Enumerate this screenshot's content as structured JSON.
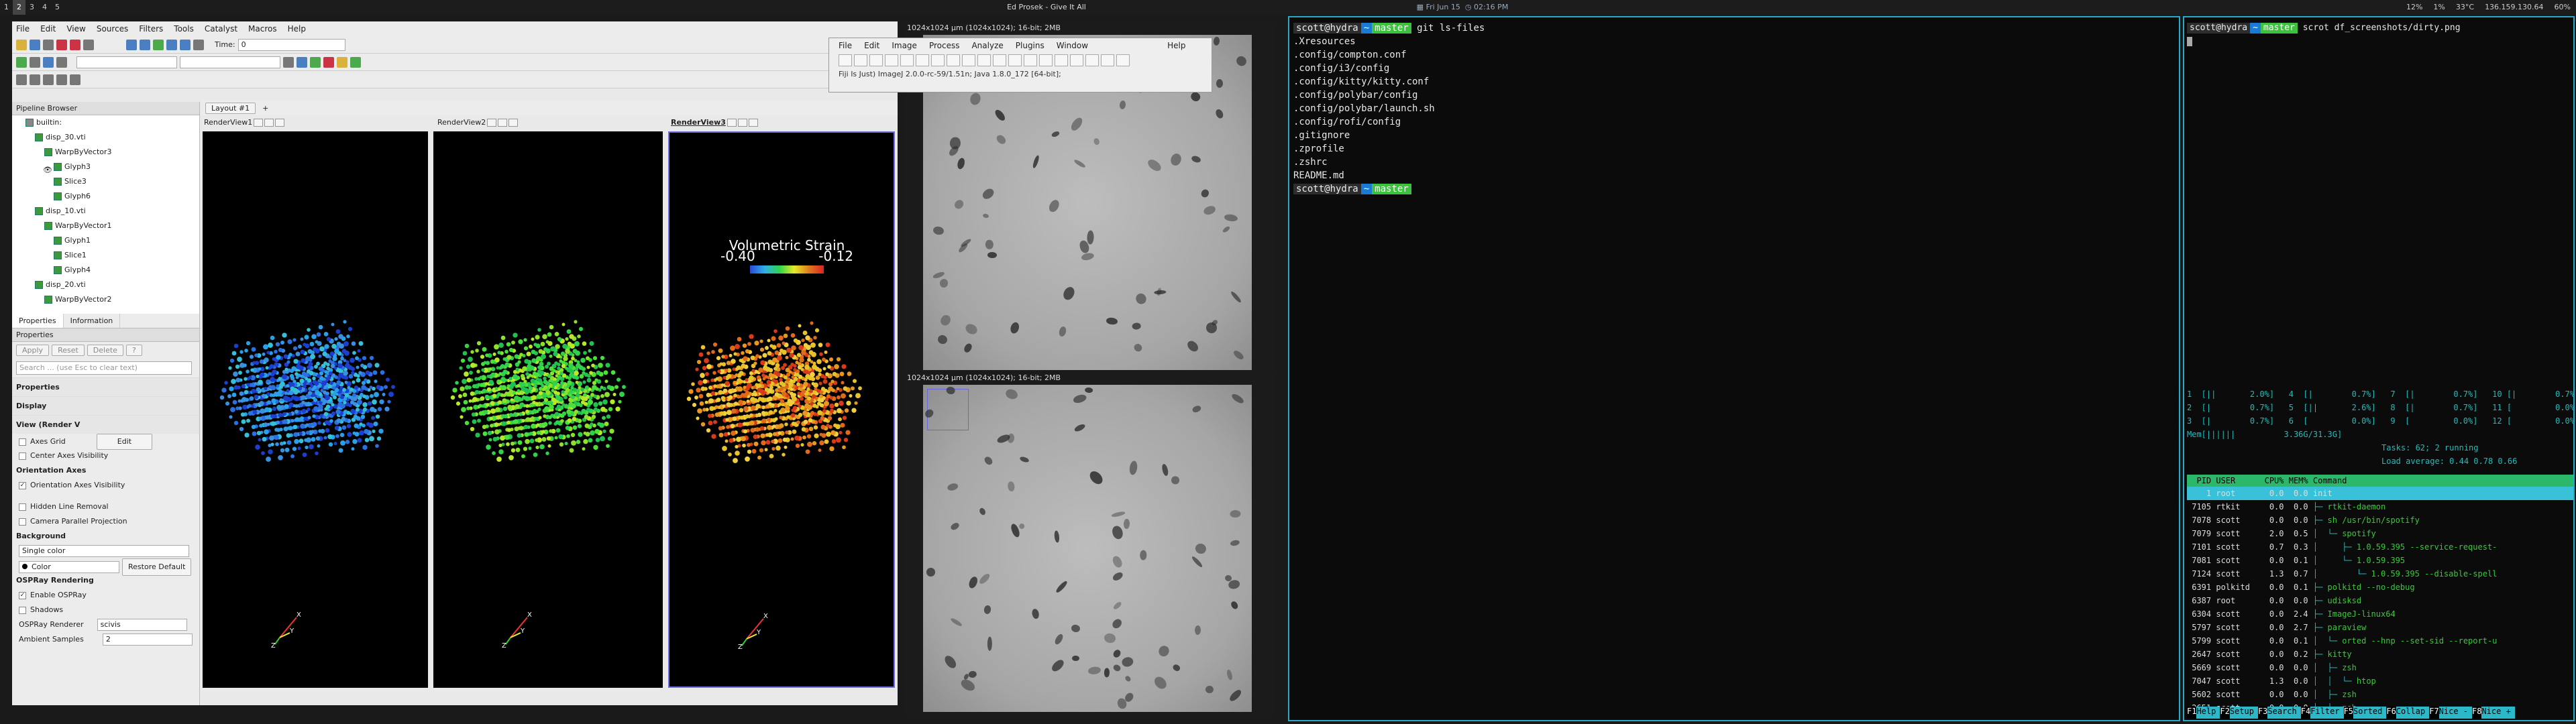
{
  "topbar": {
    "workspaces": [
      "1",
      "2",
      "3",
      "4",
      "5"
    ],
    "title": "Ed Prosek - Give It All",
    "date": "Fri Jun 15",
    "time": "02:16 PM",
    "tray": [
      "12%",
      "1%",
      "33°C",
      "136.159.130.64",
      "60%"
    ]
  },
  "paraview": {
    "menu": [
      "File",
      "Edit",
      "View",
      "Sources",
      "Filters",
      "Tools",
      "Catalyst",
      "Macros",
      "Help"
    ],
    "time_label": "Time:",
    "time_value": "0",
    "pipeline_header": "Pipeline Browser",
    "pipeline": [
      {
        "label": "builtin:",
        "level": 0
      },
      {
        "label": "disp_30.vti",
        "level": 1
      },
      {
        "label": "WarpByVector3",
        "level": 2
      },
      {
        "label": "Glyph3",
        "level": 3
      },
      {
        "label": "Slice3",
        "level": 3
      },
      {
        "label": "Glyph6",
        "level": 3
      },
      {
        "label": "disp_10.vti",
        "level": 1
      },
      {
        "label": "WarpByVector1",
        "level": 2
      },
      {
        "label": "Glyph1",
        "level": 3
      },
      {
        "label": "Slice1",
        "level": 3
      },
      {
        "label": "Glyph4",
        "level": 3
      },
      {
        "label": "disp_20.vti",
        "level": 1
      },
      {
        "label": "WarpByVector2",
        "level": 2
      }
    ],
    "tabs": [
      "Properties",
      "Information"
    ],
    "properties_header": "Properties",
    "buttons": {
      "apply": "Apply",
      "reset": "Reset",
      "delete": "Delete",
      "help": "?"
    },
    "search_placeholder": "Search ... (use Esc to clear text)",
    "sections": {
      "properties": "Properties",
      "display": "Display",
      "view": "View (Render V"
    },
    "axes_grid": "Axes Grid",
    "edit": "Edit",
    "center_axes": "Center Axes Visibility",
    "orientation_axes": "Orientation Axes",
    "orientation_visibility": "Orientation Axes Visibility",
    "hidden_line": "Hidden Line Removal",
    "camera_parallel": "Camera Parallel Projection",
    "background": "Background",
    "single_color": "Single color",
    "color": "Color",
    "restore_default": "Restore Default",
    "ospray": "OSPRay Rendering",
    "enable_ospray": "Enable OSPRay",
    "shadows": "Shadows",
    "ospray_renderer": "OSPRay Renderer",
    "renderer_value": "scivis",
    "ambient_samples": "Ambient Samples",
    "ambient_value": "2",
    "layout_tab": "Layout #1",
    "views": [
      "RenderView1",
      "RenderView2",
      "RenderView3"
    ],
    "scalar_bar": {
      "title": "Volumetric Strain",
      "min": "-0.40",
      "max": "-0.12"
    }
  },
  "imagej": {
    "menu": [
      "File",
      "Edit",
      "Image",
      "Process",
      "Analyze",
      "Plugins",
      "Window",
      "Help"
    ],
    "status": "Fiji Is Just) ImageJ 2.0.0-rc-59/1.51n; Java 1.8.0_172 [64-bit];",
    "images": [
      {
        "caption": "1024x1024 µm (1024x1024); 16-bit; 2MB"
      },
      {
        "caption": "1024x1024 µm (1024x1024); 16-bit; 2MB"
      }
    ]
  },
  "terminal1": {
    "prompt_user": "scott@hydra",
    "prompt_dir": "~",
    "prompt_branch": "master",
    "command": "git ls-files",
    "output": [
      ".Xresources",
      ".config/compton.conf",
      ".config/i3/config",
      ".config/kitty/kitty.conf",
      ".config/polybar/config",
      ".config/polybar/launch.sh",
      ".config/rofi/config",
      ".gitignore",
      ".zprofile",
      ".zshrc",
      "README.md"
    ]
  },
  "terminal2": {
    "prompt_user": "scott@hydra",
    "prompt_dir": "~",
    "prompt_branch": "master",
    "command": "scrot df_screenshots/dirty.png",
    "cpu_rows": [
      "1  [||       2.0%]   4  [|        0.7%]   7  [|        0.7%]   10 [|        0.7%]",
      "2  [|        0.7%]   5  [||       2.6%]   8  [|        0.7%]   11 [         0.0%]",
      "3  [|        0.7%]   6  [         0.0%]   9  [         0.0%]   12 [         0.0%]"
    ],
    "mem": "Mem[||||||          3.36G/31.3G]",
    "tasks": "Tasks: 62; 2 running",
    "load": "Load average: 0.44 0.78 0.66",
    "header": "  PID USER      CPU% MEM% Command",
    "procs": [
      {
        "pid": "1",
        "user": "root",
        "cpu": "0.0",
        "mem": "0.0",
        "cmd": "init",
        "tree": ""
      },
      {
        "pid": "7105",
        "user": "rtkit",
        "cpu": "0.0",
        "mem": "0.0",
        "cmd": "rtkit-daemon",
        "tree": "├─ "
      },
      {
        "pid": "7078",
        "user": "scott",
        "cpu": "0.0",
        "mem": "0.0",
        "cmd": "sh /usr/bin/spotify",
        "tree": "├─ "
      },
      {
        "pid": "7079",
        "user": "scott",
        "cpu": "2.0",
        "mem": "0.5",
        "cmd": "spotify",
        "tree": "│  └─ "
      },
      {
        "pid": "7101",
        "user": "scott",
        "cpu": "0.7",
        "mem": "0.3",
        "cmd": "1.0.59.395 --service-request-",
        "tree": "│     ├─ "
      },
      {
        "pid": "7081",
        "user": "scott",
        "cpu": "0.0",
        "mem": "0.1",
        "cmd": "1.0.59.395",
        "tree": "│     └─ "
      },
      {
        "pid": "7124",
        "user": "scott",
        "cpu": "1.3",
        "mem": "0.7",
        "cmd": "1.0.59.395 --disable-spell",
        "tree": "│        └─ "
      },
      {
        "pid": "6391",
        "user": "polkitd",
        "cpu": "0.0",
        "mem": "0.1",
        "cmd": "polkitd --no-debug",
        "tree": "├─ "
      },
      {
        "pid": "6387",
        "user": "root",
        "cpu": "0.0",
        "mem": "0.0",
        "cmd": "udisksd",
        "tree": "├─ "
      },
      {
        "pid": "6304",
        "user": "scott",
        "cpu": "0.0",
        "mem": "2.4",
        "cmd": "ImageJ-linux64",
        "tree": "├─ "
      },
      {
        "pid": "5797",
        "user": "scott",
        "cpu": "0.0",
        "mem": "2.7",
        "cmd": "paraview",
        "tree": "├─ "
      },
      {
        "pid": "5799",
        "user": "scott",
        "cpu": "0.0",
        "mem": "0.1",
        "cmd": "orted --hnp --set-sid --report-u",
        "tree": "│  └─ "
      },
      {
        "pid": "2647",
        "user": "scott",
        "cpu": "0.0",
        "mem": "0.2",
        "cmd": "kitty",
        "tree": "├─ "
      },
      {
        "pid": "5669",
        "user": "scott",
        "cpu": "0.0",
        "mem": "0.0",
        "cmd": "zsh",
        "tree": "│  ├─ "
      },
      {
        "pid": "7047",
        "user": "scott",
        "cpu": "1.3",
        "mem": "0.0",
        "cmd": "htop",
        "tree": "│  │  └─ "
      },
      {
        "pid": "5602",
        "user": "scott",
        "cpu": "0.0",
        "mem": "0.0",
        "cmd": "zsh",
        "tree": "│  ├─ "
      },
      {
        "pid": "2651",
        "user": "scott",
        "cpu": "0.0",
        "mem": "0.0",
        "cmd": "zsh",
        "tree": "│  └─ "
      }
    ],
    "footer": [
      {
        "k": "F1",
        "v": "Help"
      },
      {
        "k": "F2",
        "v": "Setup"
      },
      {
        "k": "F3",
        "v": "Search"
      },
      {
        "k": "F4",
        "v": "Filter"
      },
      {
        "k": "F5",
        "v": "Sorted"
      },
      {
        "k": "F6",
        "v": "Collap"
      },
      {
        "k": "F7",
        "v": "Nice -"
      },
      {
        "k": "F8",
        "v": "Nice +"
      }
    ]
  }
}
